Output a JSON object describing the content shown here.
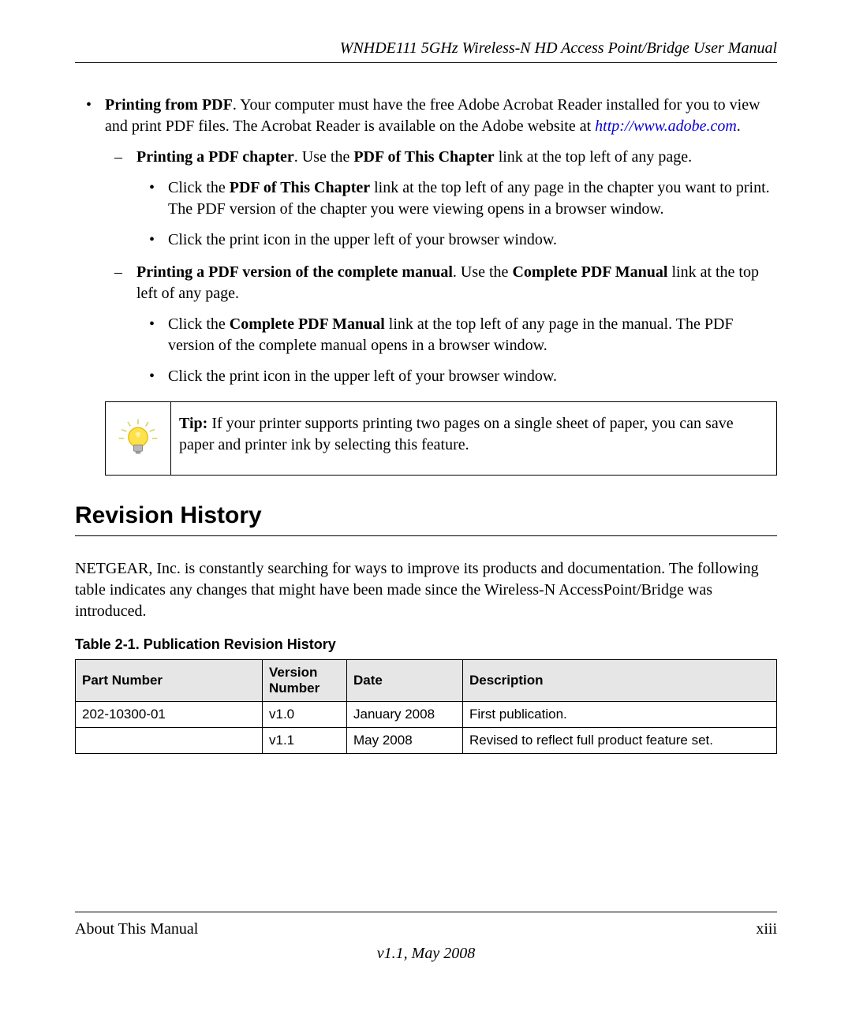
{
  "header": {
    "running_title": "WNHDE111 5GHz Wireless-N HD Access Point/Bridge User Manual"
  },
  "content": {
    "b1_lead_bold": "Printing from PDF",
    "b1_lead_rest": ". Your computer must have the free Adobe Acrobat Reader installed for you to view and print PDF files. The Acrobat Reader is available on the Adobe website at ",
    "adobe_url": "http://www.adobe.com",
    "period": ".",
    "b1a_bold": "Printing a PDF chapter",
    "b1a_rest1": ". Use the ",
    "b1a_bold2": "PDF of This Chapter",
    "b1a_rest2": " link at the top left of any page.",
    "b1a_i1_pre": "Click the ",
    "b1a_i1_bold": "PDF of This Chapter",
    "b1a_i1_post": " link at the top left of any page in the chapter you want to print. The PDF version of the chapter you were viewing opens in a browser window.",
    "b1a_i2": "Click the print icon in the upper left of your browser window.",
    "b1b_bold": "Printing a PDF version of the complete manual",
    "b1b_rest1": ". Use the ",
    "b1b_bold2": "Complete PDF Manual",
    "b1b_rest2": " link at the top left of any page.",
    "b1b_i1_pre": "Click the ",
    "b1b_i1_bold": "Complete PDF Manual",
    "b1b_i1_post": " link at the top left of any page in the manual. The PDF version of the complete manual opens in a browser window.",
    "b1b_i2": "Click the print icon in the upper left of your browser window."
  },
  "tip": {
    "label": "Tip:",
    "text": " If your printer supports printing two pages on a single sheet of paper, you can save paper and printer ink by selecting this feature."
  },
  "section_heading": "Revision History",
  "revision_intro": "NETGEAR, Inc. is constantly searching for ways to improve its products and documentation. The following table indicates any changes that might have been made since the Wireless-N AccessPoint/Bridge was introduced.",
  "table": {
    "caption": "Table 2-1.   Publication Revision History",
    "headers": {
      "part": "Part Number",
      "version": "Version Number",
      "date": "Date",
      "desc": "Description"
    },
    "rows": [
      {
        "part": "202-10300-01",
        "version": "v1.0",
        "date": "January 2008",
        "desc": "First publication."
      },
      {
        "part": "",
        "version": "v1.1",
        "date": "May 2008",
        "desc": "Revised to reflect full product feature set."
      }
    ]
  },
  "footer": {
    "left": "About This Manual",
    "right": "xiii",
    "version": "v1.1, May 2008"
  }
}
